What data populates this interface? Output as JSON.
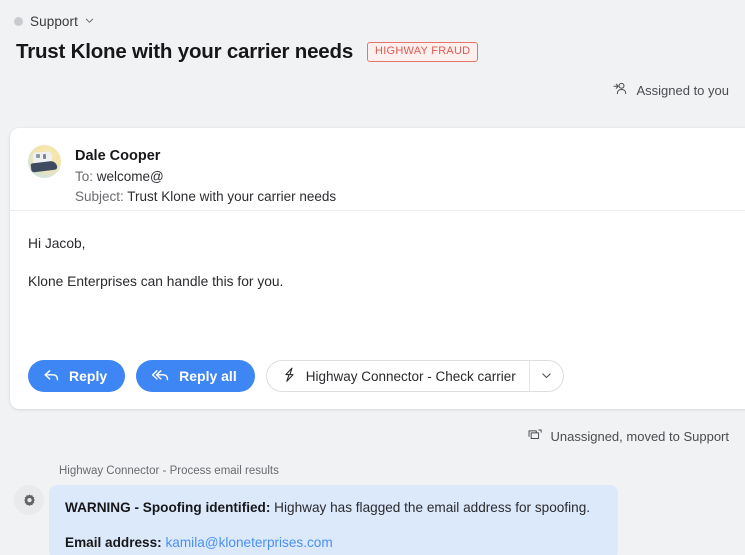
{
  "breadcrumb": {
    "label": "Support",
    "status_dot_color": "#c9cbcf",
    "chevron_icon": "chevron-down-icon"
  },
  "header": {
    "title": "Trust Klone with your carrier needs",
    "badge": {
      "label": "HIGHWAY FRAUD",
      "text_color": "#e05a50",
      "border_color": "#e8736b",
      "background_color": "#fdf0ef"
    },
    "assignment": {
      "icon": "person-add-icon",
      "label": "Assigned to you"
    }
  },
  "email": {
    "avatar_icon": "user-avatar",
    "sender": "Dale Cooper",
    "to_label": "To:",
    "to_value": "welcome@",
    "subject_label": "Subject:",
    "subject_value": "Trust Klone with your carrier needs",
    "body": [
      "Hi Jacob,",
      "Klone Enterprises can handle this for you."
    ],
    "actions": {
      "reply": {
        "label": "Reply",
        "icon": "reply-arrow-icon",
        "color": "#3f86f5"
      },
      "reply_all": {
        "label": "Reply all",
        "icon": "reply-all-arrow-icon",
        "color": "#3f86f5"
      },
      "connector": {
        "label": "Highway Connector - Check carrier",
        "icon": "lightning-bolt-icon",
        "caret_icon": "chevron-down-icon"
      }
    }
  },
  "footer": {
    "status": {
      "icon": "move-folder-icon",
      "label": "Unassigned, moved to Support"
    }
  },
  "connector_result": {
    "label": "Highway Connector - Process email results",
    "gear_icon": "gear-icon",
    "box_background": "#dce9fb",
    "warning_title": "WARNING - Spoofing identified:",
    "warning_text": "Highway has flagged the email address for spoofing.",
    "email_label": "Email address:",
    "email_value": "kamila@kloneterprises.com",
    "email_link_color": "#4a90f0"
  }
}
